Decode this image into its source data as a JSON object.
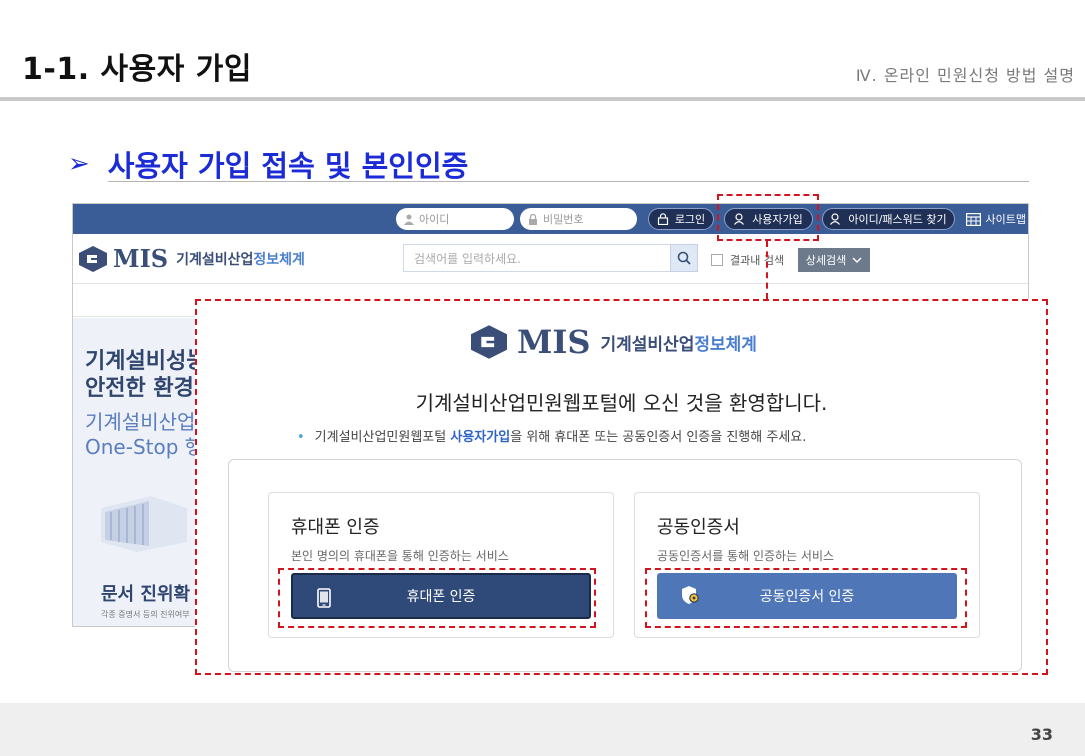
{
  "slide": {
    "title": "1-1. 사용자 가입",
    "section": "Ⅳ. 온라인 민원신청 방법 설명",
    "subtitle_bullet": "➢",
    "subtitle": "사용자 가입 접속 및 본인인증",
    "page_number": "33"
  },
  "portal": {
    "topbar": {
      "id_placeholder": "아이디",
      "pw_placeholder": "비밀번호",
      "login_label": "로그인",
      "signup_label": "사용자가입",
      "find_label": "아이디/패스워드 찾기",
      "sitemap_label": "사이트맵"
    },
    "logo": {
      "mark": "MIS",
      "name_part1": "기계설비산업",
      "name_part2": "정보체계"
    },
    "search": {
      "placeholder": "검색어를 입력하세요.",
      "in_results_label": "결과내 검색",
      "advanced_label": "상세검색"
    },
    "left_panel": {
      "hero_line1": "기계설비성능",
      "hero_line2": "안전한 환경",
      "hero_line3": "기계설비산업 정",
      "hero_line4": "One-Stop 행",
      "doc_title": "문서 진위확",
      "doc_sub": "각종 증명서 등의 진위여부"
    }
  },
  "popup": {
    "logo_mark": "MIS",
    "logo_name_part1": "기계설비산업",
    "logo_name_part2": "정보체계",
    "welcome": "기계설비산업민원웹포털에 오신 것을 환영합니다.",
    "notice_before": "기계설비산업민원웹포털 ",
    "notice_bold": "사용자가입",
    "notice_after": "을 위해 휴대폰 또는 공동인증서 인증을 진행해 주세요.",
    "phone_card": {
      "title": "휴대폰 인증",
      "desc": "본인 명의의 휴대폰을 통해 인증하는 서비스",
      "button_label": "휴대폰 인증"
    },
    "cert_card": {
      "title": "공동인증서",
      "desc": "공동인증서를 통해 인증하는 서비스",
      "button_label": "공동인증서 인증"
    }
  },
  "colors": {
    "accent_blue": "#1b2bd6",
    "topbar": "#3b5d97",
    "highlight_red": "#d3141c",
    "phone_button": "#2f4a78",
    "cert_button": "#4f77b7"
  }
}
